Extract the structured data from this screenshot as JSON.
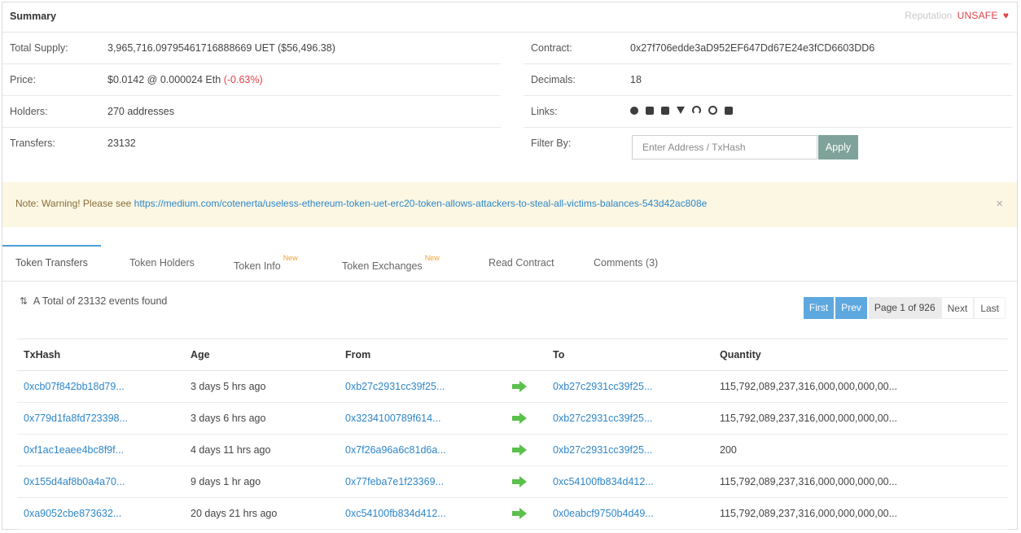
{
  "summary": {
    "title": "Summary",
    "reputation_label": "Reputation",
    "reputation_value": "UNSAFE",
    "total_supply_label": "Total Supply:",
    "total_supply_value": "3,965,716.09795461716888669 UET ($56,496.38)",
    "price_label": "Price:",
    "price_value": "$0.0142 @ 0.000024 Eth",
    "price_change": "(-0.63%)",
    "holders_label": "Holders:",
    "holders_value": "270 addresses",
    "transfers_label": "Transfers:",
    "transfers_value": "23132",
    "contract_label": "Contract:",
    "contract_value": "0x27f706edde3aD952EF647Dd67E24e3fCD6603DD6",
    "decimals_label": "Decimals:",
    "decimals_value": "18",
    "links_label": "Links:",
    "filter_label": "Filter By:",
    "filter_placeholder": "Enter Address / TxHash",
    "apply_label": "Apply"
  },
  "note": {
    "prefix": "Note: Warning! Please see",
    "link": "https://medium.com/cotenerta/useless-ethereum-token-uet-erc20-token-allows-attackers-to-steal-all-victims-balances-543d42ac808e",
    "close": "×"
  },
  "tabs": [
    {
      "label": "Token Transfers",
      "badge": ""
    },
    {
      "label": "Token Holders",
      "badge": ""
    },
    {
      "label": "Token Info",
      "badge": "New"
    },
    {
      "label": "Token Exchanges",
      "badge": "New"
    },
    {
      "label": "Read Contract",
      "badge": ""
    },
    {
      "label": "Comments (3)",
      "badge": ""
    }
  ],
  "total_text": "A Total of 23132 events found",
  "pager": {
    "first": "First",
    "prev": "Prev",
    "page": "Page 1 of 926",
    "next": "Next",
    "last": "Last"
  },
  "table": {
    "headers": [
      "TxHash",
      "Age",
      "From",
      "",
      "To",
      "Quantity"
    ],
    "rows": [
      {
        "txhash": "0xcb07f842bb18d79...",
        "age": "3 days 5 hrs ago",
        "from": "0xb27c2931cc39f25...",
        "to": "0xb27c2931cc39f25...",
        "quantity": "115,792,089,237,316,000,000,000,00..."
      },
      {
        "txhash": "0x779d1fa8fd723398...",
        "age": "3 days 6 hrs ago",
        "from": "0x3234100789f614...",
        "to": "0xb27c2931cc39f25...",
        "quantity": "115,792,089,237,316,000,000,000,00..."
      },
      {
        "txhash": "0xf1ac1eaee4bc8f9f...",
        "age": "4 days 11 hrs ago",
        "from": "0x7f26a96a6c81d6a...",
        "to": "0xb27c2931cc39f25...",
        "quantity": "200"
      },
      {
        "txhash": "0x155d4af8b0a4a70...",
        "age": "9 days 1 hr ago",
        "from": "0x77feba7e1f23369...",
        "to": "0xc54100fb834d412...",
        "quantity": "115,792,089,237,316,000,000,000,00..."
      },
      {
        "txhash": "0xa9052cbe873632...",
        "age": "20 days 21 hrs ago",
        "from": "0xc54100fb834d412...",
        "to": "0x0eabcf9750b4d49...",
        "quantity": "115,792,089,237,316,000,000,000,00..."
      }
    ]
  }
}
